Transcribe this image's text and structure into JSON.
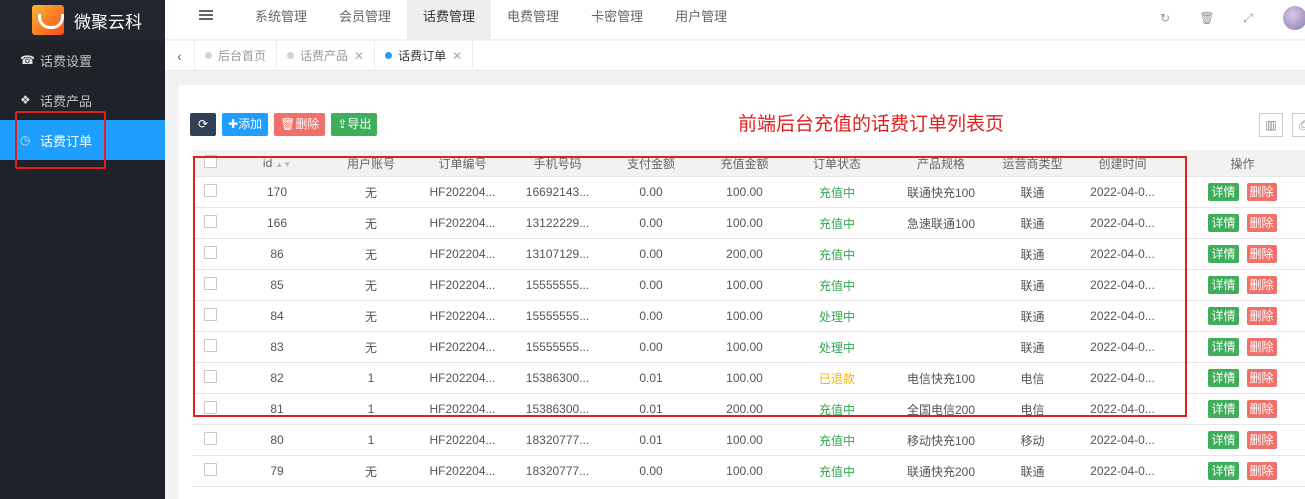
{
  "app": {
    "logo_text": "微聚云科"
  },
  "sidebar": {
    "items": [
      {
        "label": "话费设置",
        "icon": "phone-icon"
      },
      {
        "label": "话费产品",
        "icon": "cubes-icon"
      },
      {
        "label": "话费订单",
        "icon": "clock-icon",
        "active": true
      }
    ]
  },
  "topnav": {
    "items": [
      "系统管理",
      "会员管理",
      "话费管理",
      "电费管理",
      "卡密管理",
      "用户管理"
    ],
    "active": "话费管理"
  },
  "tabs": [
    {
      "label": "后台首页",
      "closable": false
    },
    {
      "label": "话费产品",
      "closable": true
    },
    {
      "label": "话费订单",
      "closable": true,
      "active": true
    }
  ],
  "toolbar": {
    "refresh_icon": "refresh-icon",
    "add_label": "添加",
    "delete_label": "删除",
    "export_label": "导出"
  },
  "annotation": "前端后台充值的话费订单列表页",
  "table": {
    "columns": [
      "id",
      "用户账号",
      "订单编号",
      "手机号码",
      "支付金额",
      "充值金额",
      "订单状态",
      "产品规格",
      "运营商类型",
      "创建时间",
      "操作"
    ],
    "rows": [
      [
        "170",
        "无",
        "HF202204...",
        "16692143...",
        "0.00",
        "100.00",
        "充值中",
        "联通快充100",
        "联通",
        "2022-04-0..."
      ],
      [
        "166",
        "无",
        "HF202204...",
        "13122229...",
        "0.00",
        "100.00",
        "充值中",
        "急速联通100",
        "联通",
        "2022-04-0..."
      ],
      [
        "86",
        "无",
        "HF202204...",
        "13107129...",
        "0.00",
        "200.00",
        "充值中",
        "",
        "联通",
        "2022-04-0..."
      ],
      [
        "85",
        "无",
        "HF202204...",
        "15555555...",
        "0.00",
        "100.00",
        "充值中",
        "",
        "联通",
        "2022-04-0..."
      ],
      [
        "84",
        "无",
        "HF202204...",
        "15555555...",
        "0.00",
        "100.00",
        "处理中",
        "",
        "联通",
        "2022-04-0..."
      ],
      [
        "83",
        "无",
        "HF202204...",
        "15555555...",
        "0.00",
        "100.00",
        "处理中",
        "",
        "联通",
        "2022-04-0..."
      ],
      [
        "82",
        "1",
        "HF202204...",
        "15386300...",
        "0.01",
        "100.00",
        "已退款",
        "电信快充100",
        "电信",
        "2022-04-0..."
      ],
      [
        "81",
        "1",
        "HF202204...",
        "15386300...",
        "0.01",
        "200.00",
        "充值中",
        "全国电信200",
        "电信",
        "2022-04-0..."
      ],
      [
        "80",
        "1",
        "HF202204...",
        "18320777...",
        "0.01",
        "100.00",
        "充值中",
        "移动快充100",
        "移动",
        "2022-04-0..."
      ],
      [
        "79",
        "无",
        "HF202204...",
        "18320777...",
        "0.00",
        "100.00",
        "充值中",
        "联通快充200",
        "联通",
        "2022-04-0..."
      ]
    ],
    "detail_label": "详情",
    "delete_label": "删除"
  },
  "colors": {
    "sidebar_bg": "#20222a",
    "active_blue": "#1e9fff",
    "status_green": "#2fa84f",
    "status_yellow": "#f0b400",
    "annotation_red": "#e02020"
  }
}
